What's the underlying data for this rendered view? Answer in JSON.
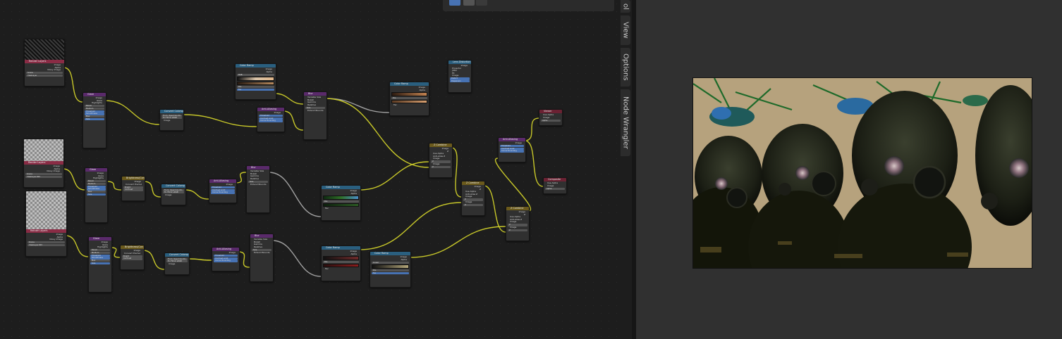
{
  "toolbar": {
    "tools": [
      "box-select",
      "lasso-select",
      "tweak"
    ]
  },
  "sidebar_tabs": [
    "ol",
    "View",
    "Options",
    "Node Wrangler"
  ],
  "colors": {
    "wire": "#c7c729",
    "wire_gray": "#a1a1a1",
    "backdrop": "#1d1d1d"
  },
  "nodes": {
    "rl1": {
      "title": "Render Layers",
      "outs": [
        "Image",
        "Alpha",
        "Noisy Image"
      ],
      "scene": "Scene",
      "layer": "ViewLayer"
    },
    "rl2": {
      "title": "Render Layers",
      "outs": [
        "Image",
        "Alpha",
        "Noisy Image"
      ],
      "scene": "Scene",
      "layer": "ViewLayer.002"
    },
    "rl3": {
      "title": "Render Layers",
      "outs": [
        "Image",
        "Alpha",
        "Noisy Image"
      ],
      "scene": "Scene",
      "layer": "ViewLayer.003"
    },
    "glare1": {
      "title": "Glare",
      "outs": [
        "Image",
        "Glare",
        "Highlights"
      ],
      "type": "Bloom",
      "quality": "Medium",
      "params": [
        "Threshold",
        "Smoothness",
        "Max",
        "Size"
      ]
    },
    "glare2": {
      "title": "Glare",
      "outs": [
        "Image",
        "Glare",
        "Highlights"
      ],
      "type": "Bloom",
      "quality": "Medium",
      "params": [
        "Threshold",
        "Smoothness",
        "Max",
        "Size"
      ]
    },
    "glare3": {
      "title": "Glare",
      "outs": [
        "Image",
        "Glare",
        "Highlights"
      ],
      "type": "Bloom",
      "quality": "Medium",
      "params": [
        "Threshold",
        "Smoothness",
        "Max",
        "Size"
      ]
    },
    "cc1": {
      "title": "Convert Colorsp",
      "from": "From: OpenColorIO...",
      "to": "To: Filmic sRGB",
      "in": "Image"
    },
    "cc2": {
      "title": "Convert Colorsp",
      "from": "From: OpenColorIO...",
      "to": "To: Filmic sRGB",
      "in": "Image"
    },
    "cc3": {
      "title": "Convert Colorsp",
      "from": "From: OpenColorIO...",
      "to": "To: Filmic sRGB",
      "in": "Image"
    },
    "bc2": {
      "title": "Brightness/Con",
      "in": "Image",
      "opt": "Convert Premul",
      "bright": "Bright",
      "contrast": "Contrast"
    },
    "bc3": {
      "title": "Brightness/Con",
      "in": "Image",
      "opt": "Convert Premul",
      "bright": "Bright",
      "contrast": "Contrast"
    },
    "aa1": {
      "title": "Anti-Aliasing",
      "in": "Image",
      "params": [
        "Threshold",
        "Contrast Limit",
        "Corner Rounding"
      ]
    },
    "aa2": {
      "title": "Anti-Aliasing",
      "in": "Image",
      "params": [
        "Threshold",
        "Contrast Limit",
        "Corner Rounding"
      ]
    },
    "aa3": {
      "title": "Anti-Aliasing",
      "in": "Image",
      "params": [
        "Threshold",
        "Contrast Limit",
        "Corner Rounding"
      ]
    },
    "aa4": {
      "title": "Anti-Aliasing",
      "in": "Image",
      "params": [
        "Threshold",
        "Contrast Limit",
        "Corner Rounding"
      ]
    },
    "ramp1": {
      "title": "Color Ramp",
      "outs": [
        "Image",
        "Alpha"
      ],
      "mode": "RGB",
      "interp": "Ease",
      "pos": "Pos",
      "fac": "Fac"
    },
    "ramp2": {
      "title": "Color Ramp",
      "outs": [
        "Image",
        "Alpha"
      ],
      "mode": "RGB",
      "interp": "Ease",
      "pos": "Pos",
      "fac": "Fac"
    },
    "ramp3": {
      "title": "Color Ramp",
      "outs": [
        "Image",
        "Alpha"
      ],
      "mode": "RGB",
      "interp": "Ease",
      "pos": "Pos",
      "fac": "Fac"
    },
    "ramp4": {
      "title": "Color Ramp",
      "outs": [
        "Image",
        "Alpha"
      ],
      "mode": "RGB",
      "interp": "Ease",
      "pos": "Pos",
      "fac": "Fac"
    },
    "ramp5": {
      "title": "Color Ramp",
      "outs": [
        "Image",
        "Alpha"
      ],
      "mode": "RGB",
      "interp": "Linear",
      "pos": "Pos",
      "fac": "Fac"
    },
    "blur1": {
      "title": "Blur",
      "opts": [
        "Variable Size",
        "Bokeh",
        "Gamma",
        "Relative"
      ],
      "size": "Size",
      "ext": "Extend Bounds"
    },
    "blur2": {
      "title": "Blur",
      "opts": [
        "Variable Size",
        "Bokeh",
        "Gamma",
        "Relative"
      ],
      "size": "Size",
      "ext": "Extend Bounds"
    },
    "blur3": {
      "title": "Blur",
      "opts": [
        "Variable Size",
        "Bokeh",
        "Gamma",
        "Relative"
      ],
      "size": "Size",
      "ext": "Extend Bounds"
    },
    "lens": {
      "title": "Lens Distortion",
      "out": "Image",
      "opts": [
        "Projector",
        "Jitter",
        "Fit"
      ],
      "in": "Image",
      "dist": "Distort",
      "disp": "Dispersion"
    },
    "zc1": {
      "title": "Z Combine",
      "outs": [
        "Image",
        "Z"
      ],
      "opts": [
        "Use Alpha",
        "Anti-Alias Z"
      ],
      "ins": [
        "Image",
        "Z",
        "Image",
        "Z"
      ]
    },
    "zc2": {
      "title": "Z Combine",
      "outs": [
        "Image",
        "Z"
      ],
      "opts": [
        "Use Alpha",
        "Anti-Alias Z"
      ],
      "ins": [
        "Image",
        "Z",
        "Image",
        "Z"
      ]
    },
    "zc3": {
      "title": "Z Combine",
      "outs": [
        "Image",
        "Z"
      ],
      "opts": [
        "Use Alpha",
        "Anti-Alias Z"
      ],
      "ins": [
        "Image",
        "Z",
        "Image",
        "Z"
      ]
    },
    "viewer": {
      "title": "Viewer",
      "opt": "Use Alpha",
      "ins": [
        "Image",
        "Alpha"
      ]
    },
    "composite": {
      "title": "Composite",
      "opt": "Use Alpha",
      "ins": [
        "Image",
        "Alpha"
      ]
    }
  }
}
